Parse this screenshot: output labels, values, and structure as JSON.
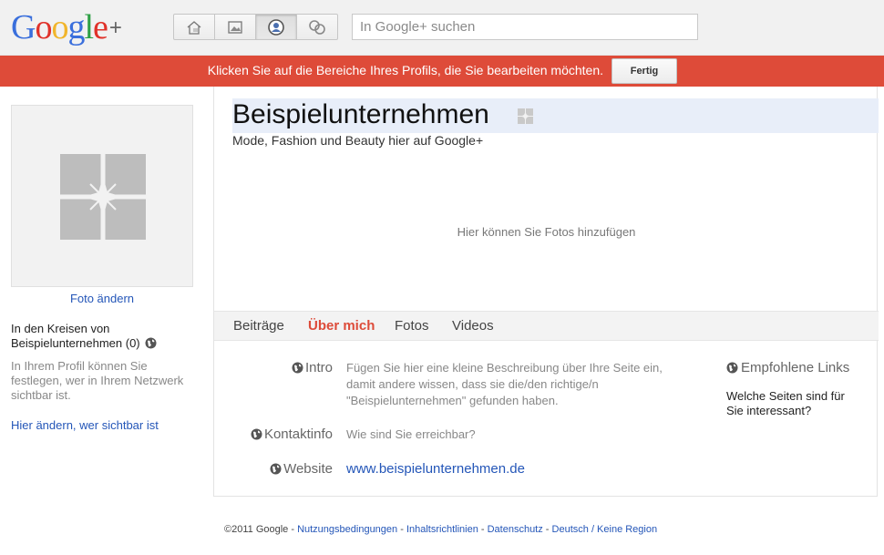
{
  "header": {
    "logo_text": "Google+",
    "search_placeholder": "In Google+ suchen",
    "nav_icons": [
      "home-icon",
      "photos-icon",
      "profile-icon",
      "circles-icon"
    ]
  },
  "banner": {
    "message": "Klicken Sie auf die Bereiche Ihres Profils, die Sie bearbeiten möchten.",
    "done_label": "Fertig",
    "color": "#de4b39"
  },
  "sidebar": {
    "change_photo": "Foto ändern",
    "circles_label": "In den Kreisen von Beispielunternehmen (0)",
    "privacy_note": "In Ihrem Profil können Sie festlegen, wer in Ihrem Netzwerk sichtbar ist.",
    "change_visibility": "Hier ändern, wer sichtbar ist"
  },
  "profile": {
    "name": "Beispielunternehmen",
    "tagline": "Mode, Fashion und Beauty hier auf Google+",
    "photos_hint": "Hier können Sie Fotos hinzufügen",
    "tabs": [
      {
        "label": "Beiträge",
        "active": false
      },
      {
        "label": "Über mich",
        "active": true
      },
      {
        "label": "Fotos",
        "active": false
      },
      {
        "label": "Videos",
        "active": false
      }
    ],
    "about": {
      "intro_label": "Intro",
      "intro_text": "Fügen Sie hier eine kleine Beschreibung über Ihre Seite ein, damit andere wissen, dass sie die/den richtige/n \"Beispielunternehmen\" gefunden haben.",
      "contact_label": "Kontaktinfo",
      "contact_text": "Wie sind Sie erreichbar?",
      "website_label": "Website",
      "website_url": "www.beispielunternehmen.de",
      "links_title": "Empfohlene Links",
      "links_question": "Welche Seiten sind für Sie interessant?"
    }
  },
  "footer": {
    "copyright": "©2011 Google - ",
    "links": [
      "Nutzungsbedingungen",
      "Inhaltsrichtlinien",
      "Datenschutz",
      "Deutsch / Keine Region"
    ],
    "separator": " - "
  },
  "colors": {
    "accent_red": "#dd4b39",
    "link_blue": "#2456b8"
  }
}
